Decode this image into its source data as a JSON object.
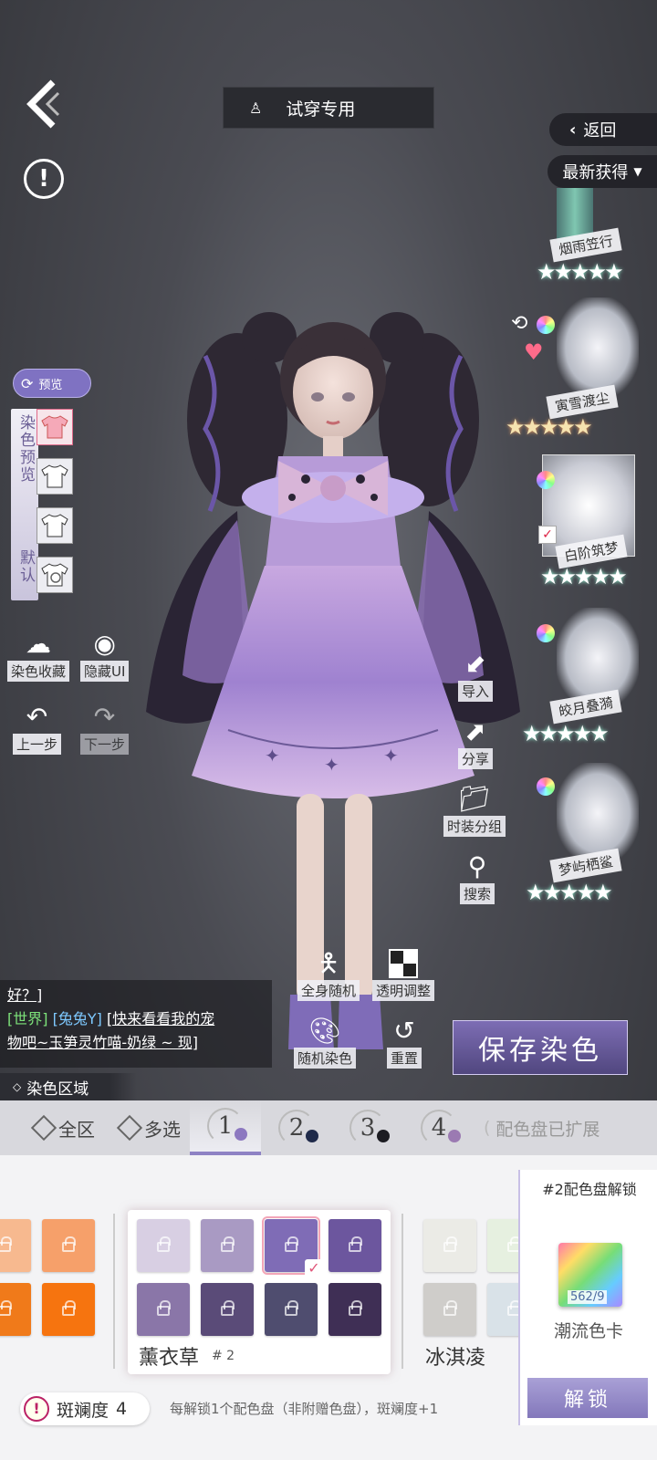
{
  "top": {
    "try_on_label": "试穿专用",
    "return_label": "返回",
    "sort_label": "最新获得"
  },
  "preview": {
    "tab_label": "预览",
    "dye_preview_label": "染色预览",
    "default_label": "默认"
  },
  "left_actions": {
    "dye_collect": "染色收藏",
    "hide_ui": "隐藏UI",
    "undo": "上一步",
    "redo": "下一步"
  },
  "right_actions": {
    "import": "导入",
    "share": "分享",
    "outfit_group": "时装分组",
    "search": "搜索"
  },
  "outfits": [
    {
      "name": "烟雨笠行",
      "stars": "★★★★★"
    },
    {
      "name": "寅雪渡尘",
      "stars": "★★★★★"
    },
    {
      "name": "白阶筑梦",
      "stars": "★★★★★"
    },
    {
      "name": "皎月叠漪",
      "stars": "★★★★★"
    },
    {
      "name": "梦屿栖鲨",
      "stars": "★★★★★"
    }
  ],
  "chat": {
    "line1": "好？]",
    "channel": "[世界]",
    "user": "[兔兔Y]",
    "message_part1": "[快来看看我的宠",
    "message_part2": "物吧~玉笋灵竹喵-奶绿 ~ 现]"
  },
  "center_actions": {
    "full_random": "全身随机",
    "transparency": "透明调整",
    "random_dye": "随机染色",
    "reset": "重置"
  },
  "save_label": "保存染色",
  "dye_region": {
    "label": "染色区域",
    "all": "全区",
    "multi": "多选",
    "slots": [
      {
        "num": "1",
        "color": "#8c78c0"
      },
      {
        "num": "2",
        "color": "#1f2a4a"
      },
      {
        "num": "3",
        "color": "#1c1c22"
      },
      {
        "num": "4",
        "color": "#9b7ab2"
      }
    ],
    "expanded_text": "配色盘已扩展"
  },
  "palettes": {
    "left_colors": [
      "#f7b98f",
      "#f6a06a",
      "#f07a1a",
      "#f6740f"
    ],
    "lavender": {
      "name": "薰衣草",
      "num": "# 2",
      "colors": [
        "#d8cfe3",
        "#a99ac3",
        "#7f6cb6",
        "#6c569e",
        "#8a76a8",
        "#5a4b78",
        "#4f4d6f",
        "#3f2f55"
      ],
      "selected_index": 2
    },
    "icecream": {
      "name": "冰淇凌",
      "colors": [
        "#ebebe6",
        "#e6f0e0",
        "#cfcdca",
        "#d9e2e8"
      ]
    }
  },
  "unlock": {
    "title": "#2配色盘解锁",
    "count": "562/9",
    "card_name": "潮流色卡",
    "button": "解锁"
  },
  "brilliance": {
    "label": "斑斓度",
    "value": "4",
    "hint": "每解锁1个配色盘（非附赠色盘），斑斓度+1"
  }
}
